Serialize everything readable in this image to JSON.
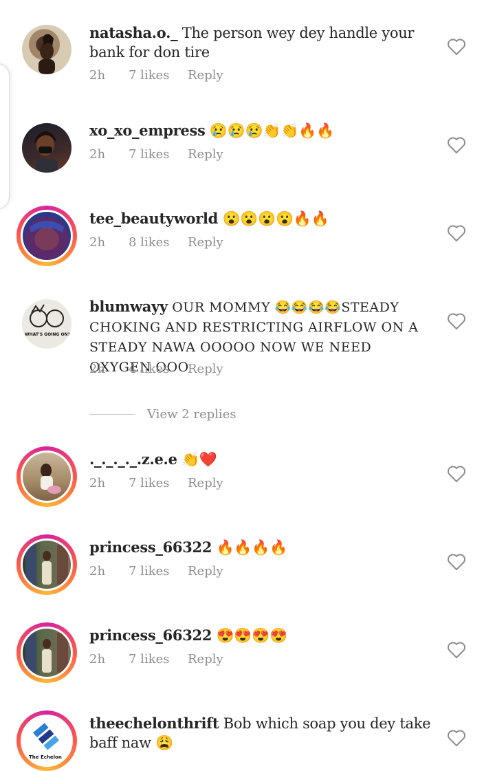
{
  "comments": [
    {
      "username": "natasha.o._",
      "text": "The person wey dey handle your bank for don tire",
      "time": "2h",
      "likes": "7 likes",
      "reply": "Reply"
    },
    {
      "username": "xo_xo_empress",
      "text": "😢😢😢👏👏🔥🔥",
      "time": "2h",
      "likes": "7 likes",
      "reply": "Reply"
    },
    {
      "username": "tee_beautyworld",
      "text": "😮😮😮😮🔥🔥",
      "time": "2h",
      "likes": "8 likes",
      "reply": "Reply"
    },
    {
      "username": "blumwayy",
      "text": "OUR MOMMY 😂😂😂😂STEADY CHOKING AND RESTRICTING AIRFLOW ON A STEADY NAWA OOOOO NOW WE NEED OXYGEN OOO",
      "time": "2h",
      "likes": "4 likes",
      "reply": "Reply"
    },
    {
      "username": "._._._._.z.e.e",
      "text": "👏❤️",
      "time": "2h",
      "likes": "7 likes",
      "reply": "Reply"
    },
    {
      "username": "princess_66322",
      "text": "🔥🔥🔥🔥",
      "time": "2h",
      "likes": "7 likes",
      "reply": "Reply"
    },
    {
      "username": "princess_66322",
      "text": "😍😍😍😍",
      "time": "2h",
      "likes": "7 likes",
      "reply": "Reply"
    },
    {
      "username": "theechelonthrift",
      "text": "Bob which soap you dey take baff naw 😩",
      "time": "",
      "likes": "",
      "reply": ""
    }
  ],
  "view_replies": "View 2 replies",
  "avatars": {
    "blumwayy_badge": "WHAT'S GOING ON?",
    "echelon_logo": "The Echelon"
  },
  "colors": {
    "meta": "#8e8e8e",
    "text": "#262626",
    "story_ring": [
      "#d6249f",
      "#fd5949",
      "#fdb836"
    ]
  },
  "icons": {
    "like": "heart-outline-icon"
  }
}
